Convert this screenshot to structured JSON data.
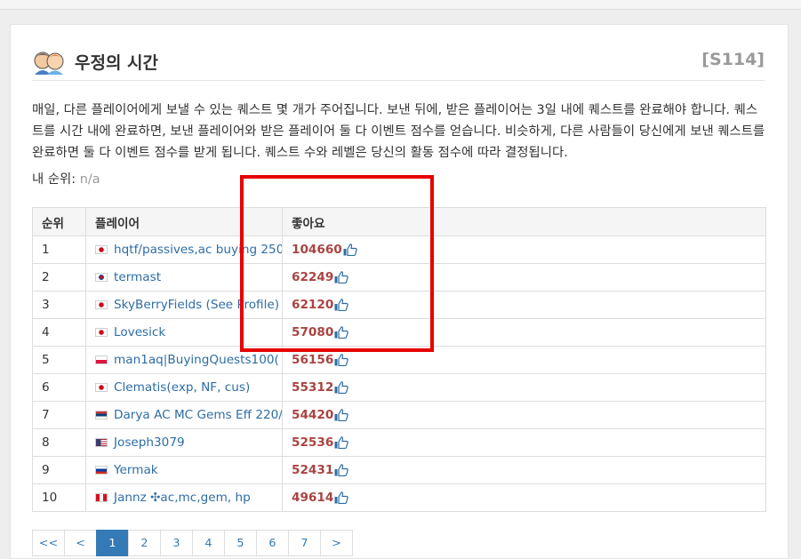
{
  "header": {
    "title": "우정의 시간",
    "season": "[S114]",
    "icon": "friends-icon"
  },
  "description": "매일, 다른 플레이어에게 보낼 수 있는 퀘스트 몇 개가 주어집니다. 보낸 뒤에, 받은 플레이어는 3일 내에 퀘스트를 완료해야 합니다. 퀘스트를 시간 내에 완료하면, 보낸 플레이어와 받은 플레이어 둘 다 이벤트 점수를 얻습니다. 비슷하게, 다른 사람들이 당신에게 보낸 퀘스트를 완료하면 둘 다 이벤트 점수를 받게 됩니다. 퀘스트 수와 레벨은 당신의 활동 점수에 따라 결정됩니다.",
  "my_rank": {
    "label": "내 순위: ",
    "value": "n/a"
  },
  "table": {
    "headers": {
      "rank": "순위",
      "player": "플레이어",
      "likes": "좋아요"
    },
    "rows": [
      {
        "rank": "1",
        "flag": "jp",
        "player": "hqtf/passives,ac buying 250",
        "likes": "104660"
      },
      {
        "rank": "2",
        "flag": "kr",
        "player": "termast",
        "likes": "62249"
      },
      {
        "rank": "3",
        "flag": "jp",
        "player": "SkyBerryFields (See Profile)",
        "likes": "62120"
      },
      {
        "rank": "4",
        "flag": "jp",
        "player": "Lovesick",
        "likes": "57080"
      },
      {
        "rank": "5",
        "flag": "pl",
        "player": "man1aq|BuyingQuests100(",
        "likes": "56156"
      },
      {
        "rank": "6",
        "flag": "jp",
        "player": "Clematis(exp, NF, cus)",
        "likes": "55312"
      },
      {
        "rank": "7",
        "flag": "rs",
        "player": "Darya AC MC Gems Eff 220/",
        "likes": "54420"
      },
      {
        "rank": "8",
        "flag": "us",
        "player": "Joseph3079",
        "likes": "52536"
      },
      {
        "rank": "9",
        "flag": "ru",
        "player": "Yermak",
        "likes": "52431"
      },
      {
        "rank": "10",
        "flag": "pe",
        "player": "Jannz ✣ac,mc,gem, hp",
        "likes": "49614"
      }
    ]
  },
  "pagination": [
    "<<",
    "<",
    "1",
    "2",
    "3",
    "4",
    "5",
    "6",
    "7",
    ">"
  ],
  "pagination_active": "1",
  "colors": {
    "link": "#2e6da4",
    "likes": "#a94442",
    "active_page": "#337ab7",
    "highlight_box": "#e60000"
  }
}
